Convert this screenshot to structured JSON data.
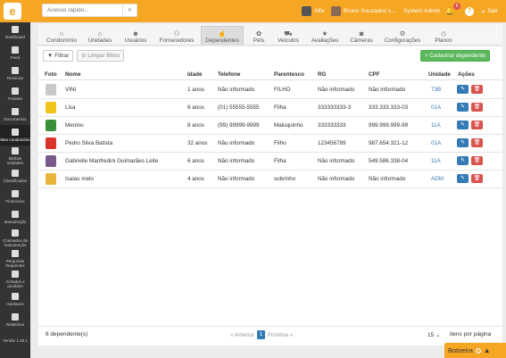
{
  "top": {
    "logo": "e",
    "search_placeholder": "Acesso rápido...",
    "alfa": "Alfa",
    "user": "Bruno Souzados s...",
    "role": "System Admin",
    "notif_count": "6",
    "exit": "Sair"
  },
  "sidebar": [
    {
      "label": "Dashboard",
      "icon": "dashboard-icon"
    },
    {
      "label": "Feed",
      "icon": "feed-icon"
    },
    {
      "label": "Reservar",
      "icon": "calendar-icon"
    },
    {
      "label": "Portaria",
      "icon": "door-icon"
    },
    {
      "label": "Documentos",
      "icon": "document-icon"
    },
    {
      "label": "Meu condomínio",
      "icon": "building-icon"
    },
    {
      "label": "Minhas unidades",
      "icon": "home-icon"
    },
    {
      "label": "Classificados",
      "icon": "tag-icon"
    },
    {
      "label": "Financeiro",
      "icon": "money-icon"
    },
    {
      "label": "Manutenção",
      "icon": "wrench-icon"
    },
    {
      "label": "Chamados de manutenção",
      "icon": "ticket-icon"
    },
    {
      "label": "Perguntas frequentes",
      "icon": "question-icon"
    },
    {
      "label": "Achados e perdidos",
      "icon": "search-icon"
    },
    {
      "label": "Hardware",
      "icon": "hardware-icon"
    },
    {
      "label": "Relatórios",
      "icon": "report-icon"
    },
    {
      "label": "Versão 1.36.1",
      "icon": ""
    }
  ],
  "tabs": [
    {
      "label": "Condomínio",
      "icon": "⌂"
    },
    {
      "label": "Unidades",
      "icon": "⌂"
    },
    {
      "label": "Usuários",
      "icon": "☻"
    },
    {
      "label": "Fornecedores",
      "icon": "⚇"
    },
    {
      "label": "Dependentes",
      "icon": "☝"
    },
    {
      "label": "Pets",
      "icon": "✿"
    },
    {
      "label": "Veículos",
      "icon": "⛟"
    },
    {
      "label": "Avaliações",
      "icon": "★"
    },
    {
      "label": "Câmeras",
      "icon": "◙"
    },
    {
      "label": "Configurações",
      "icon": "⚙"
    },
    {
      "label": "Planos",
      "icon": "◇"
    }
  ],
  "toolbar": {
    "filter": "Filtrar",
    "clear": "Limpar filtros",
    "add": "+ Cadastrar dependente"
  },
  "table": {
    "headers": [
      "Foto",
      "Nome",
      "Idade",
      "Telefone",
      "Parentesco",
      "RG",
      "CPF",
      "Unidade",
      "Ações"
    ],
    "rows": [
      {
        "nome": "VINI",
        "idade": "1 anos",
        "telefone": "Não informado",
        "parentesco": "FILHO",
        "rg": "Não informado",
        "cpf": "Não informado",
        "unidade": "73B",
        "photo_color": "#c8c8c8"
      },
      {
        "nome": "Lisa",
        "idade": "6 anos",
        "telefone": "(01) 55555-5555",
        "parentesco": "Filha",
        "rg": "333333333-3",
        "cpf": "333.333.333-03",
        "unidade": "01A",
        "photo_color": "#f0c419"
      },
      {
        "nome": "Menino",
        "idade": "8 anos",
        "telefone": "(99) 99999-9999",
        "parentesco": "Maluquinho",
        "rg": "333333333",
        "cpf": "999.999.999-99",
        "unidade": "11A",
        "photo_color": "#3a8f3a"
      },
      {
        "nome": "Pedro Silva Batista",
        "idade": "32 anos",
        "telefone": "Não informado",
        "parentesco": "Filho",
        "rg": "123456789",
        "cpf": "987.654.321-12",
        "unidade": "01A",
        "photo_color": "#d9342b"
      },
      {
        "nome": "Gabrielle Manfredini Guimarães Leite",
        "idade": "6 anos",
        "telefone": "Não informado",
        "parentesco": "Filha",
        "rg": "Não informado",
        "cpf": "549.586.338-04",
        "unidade": "11A",
        "photo_color": "#7a5a8a"
      },
      {
        "nome": "Isaias melo",
        "idade": "4 anos",
        "telefone": "Não informado",
        "parentesco": "sobrinho",
        "rg": "Não informado",
        "cpf": "Não informado",
        "unidade": "ADM",
        "photo_color": "#e8b53a"
      }
    ]
  },
  "footer": {
    "count": "6 dependente(s)",
    "prev": "« Anterior",
    "page": "1",
    "next": "Próxima »",
    "per_page_value": "15",
    "per_page_label": "itens por página"
  },
  "botoeira": "Botoeira"
}
